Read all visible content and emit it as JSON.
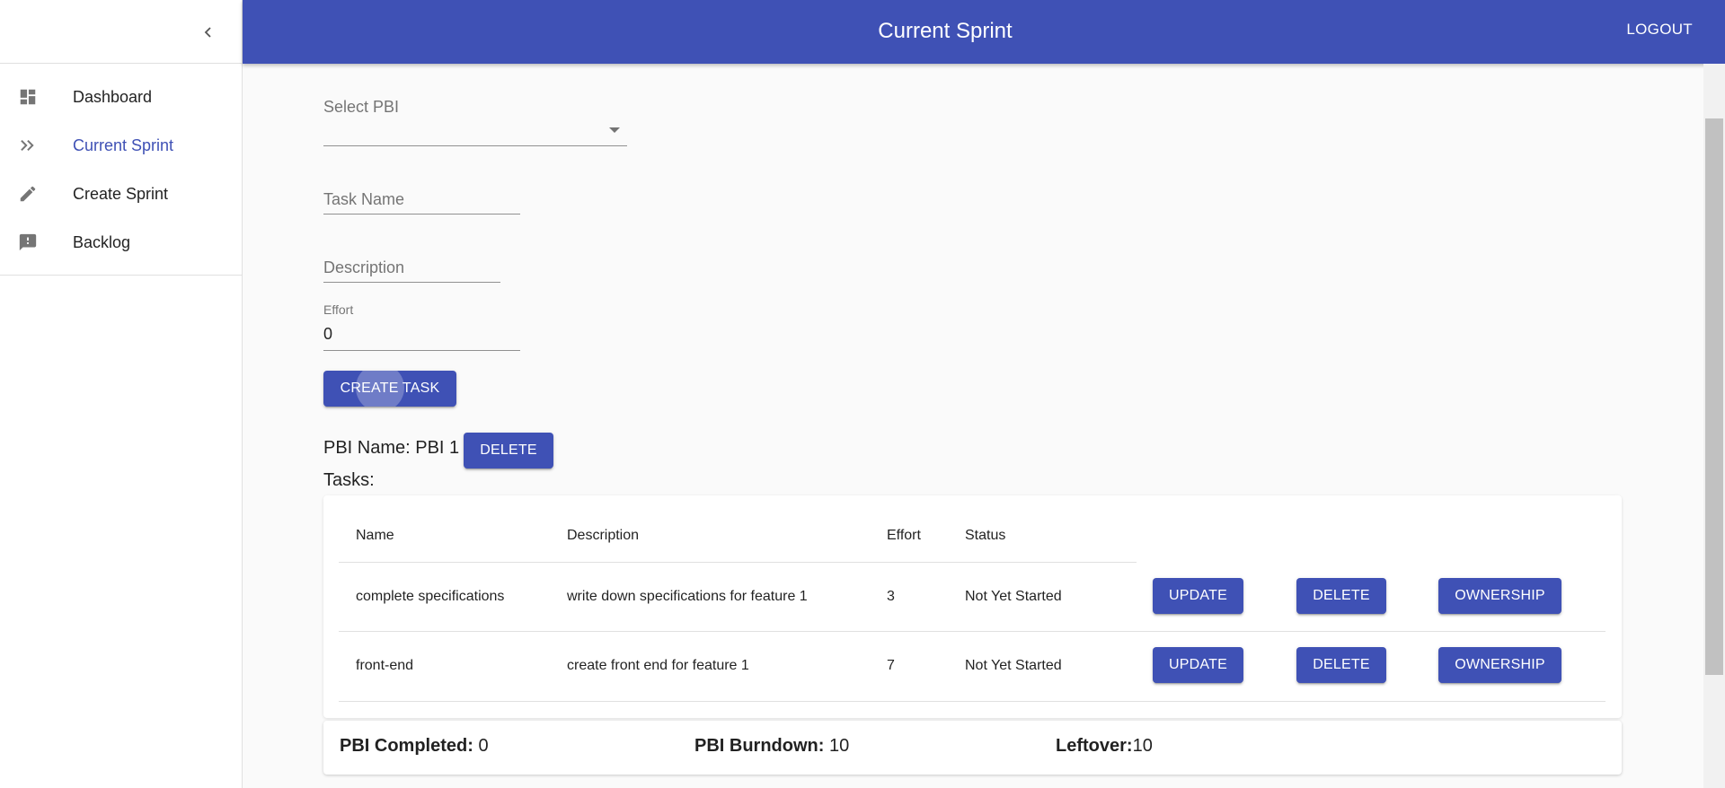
{
  "appbar": {
    "title": "Current Sprint",
    "logout_label": "LOGOUT",
    "color": "#3f51b5"
  },
  "sidebar": {
    "items": [
      {
        "label": "Dashboard",
        "icon": "dashboard-icon"
      },
      {
        "label": "Current Sprint",
        "icon": "double-chevron-right-icon",
        "active": true
      },
      {
        "label": "Create Sprint",
        "icon": "pencil-icon"
      },
      {
        "label": "Backlog",
        "icon": "feedback-icon"
      }
    ]
  },
  "form": {
    "select_pbi_label": "Select PBI",
    "select_pbi_value": "",
    "task_name_placeholder": "Task Name",
    "description_placeholder": "Description",
    "effort_label": "Effort",
    "effort_value": "0",
    "create_task_label": "CREATE TASK"
  },
  "pbi": {
    "name_prefix": "PBI Name: PBI 1",
    "delete_label": "DELETE",
    "tasks_label": "Tasks:"
  },
  "table": {
    "headers": [
      "Name",
      "Description",
      "Effort",
      "Status"
    ],
    "rows": [
      {
        "name": "complete specifications",
        "description": "write down specifications for feature 1",
        "effort": "3",
        "status": "Not Yet Started"
      },
      {
        "name": "front-end",
        "description": "create front end for feature 1",
        "effort": "7",
        "status": "Not Yet Started"
      }
    ],
    "actions": {
      "update": "UPDATE",
      "delete": "DELETE",
      "ownership": "OWNERSHIP"
    }
  },
  "footer": {
    "completed_label": "PBI Completed:",
    "completed_value": "0",
    "burndown_label": "PBI Burndown:",
    "burndown_value": "10",
    "leftover_label": "Leftover:",
    "leftover_value": "10"
  }
}
